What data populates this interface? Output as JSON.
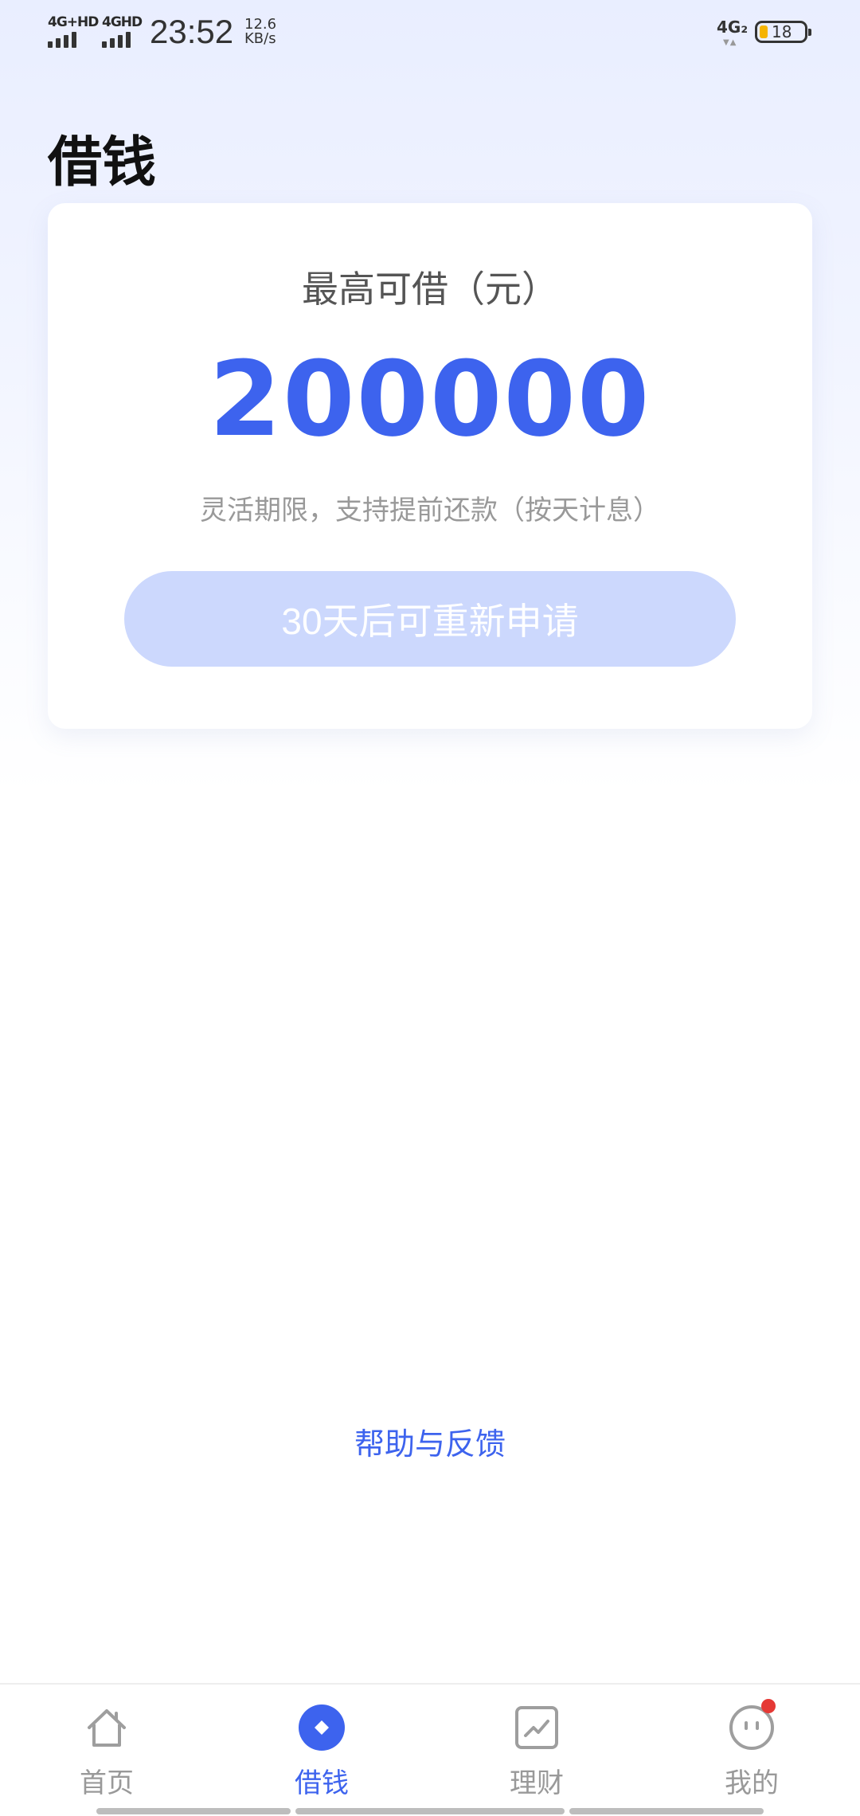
{
  "status_bar": {
    "sim1_label": "4G+HD",
    "sim2_label": "4GHD",
    "time": "23:52",
    "speed_value": "12.6",
    "speed_unit": "KB/s",
    "network_right": "4G₂",
    "battery_level": "18"
  },
  "page": {
    "title": "借钱"
  },
  "loan_card": {
    "label": "最高可借（元）",
    "amount": "200000",
    "description": "灵活期限，支持提前还款（按天计息）",
    "button_label": "30天后可重新申请"
  },
  "help": {
    "label": "帮助与反馈"
  },
  "bottom_nav": {
    "items": [
      {
        "label": "首页",
        "icon": "home-icon"
      },
      {
        "label": "借钱",
        "icon": "loan-icon"
      },
      {
        "label": "理财",
        "icon": "finance-chart-icon"
      },
      {
        "label": "我的",
        "icon": "profile-face-icon"
      }
    ]
  },
  "colors": {
    "accent": "#3d63ee",
    "button_disabled": "#ccd8fd",
    "badge": "#e53935"
  }
}
